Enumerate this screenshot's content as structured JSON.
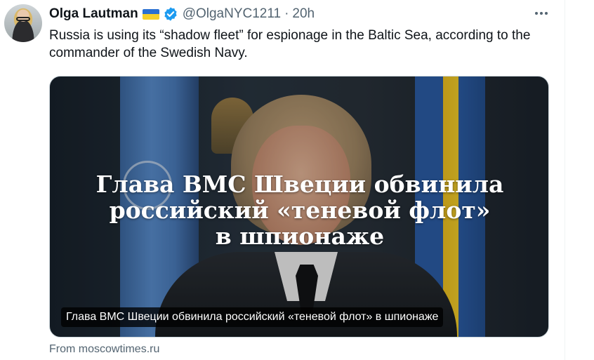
{
  "author": {
    "name": "Olga Lautman",
    "handle": "@OlgaNYC1211",
    "separator": "·",
    "time": "20h",
    "flag_colors": [
      "#2a6fd1",
      "#f5cf2a"
    ],
    "verified_color": "#1d9bf0"
  },
  "tweet": {
    "text": "Russia is using its “shadow fleet” for espionage in the Baltic Sea, according to the commander of the Swedish Navy."
  },
  "card": {
    "headline_lines": [
      "Глава ВМС Швеции обвинила",
      "российский «теневой флот»",
      "в шпионаже"
    ],
    "caption": "Глава ВМС Швеции обвинила российский «теневой флот» в шпионаже"
  },
  "source": {
    "prefix": "From",
    "domain": "moscowtimes.ru"
  },
  "icons": {
    "more": "more-dots-icon",
    "verified": "verified-badge-icon",
    "flag": "ukraine-flag-icon"
  }
}
